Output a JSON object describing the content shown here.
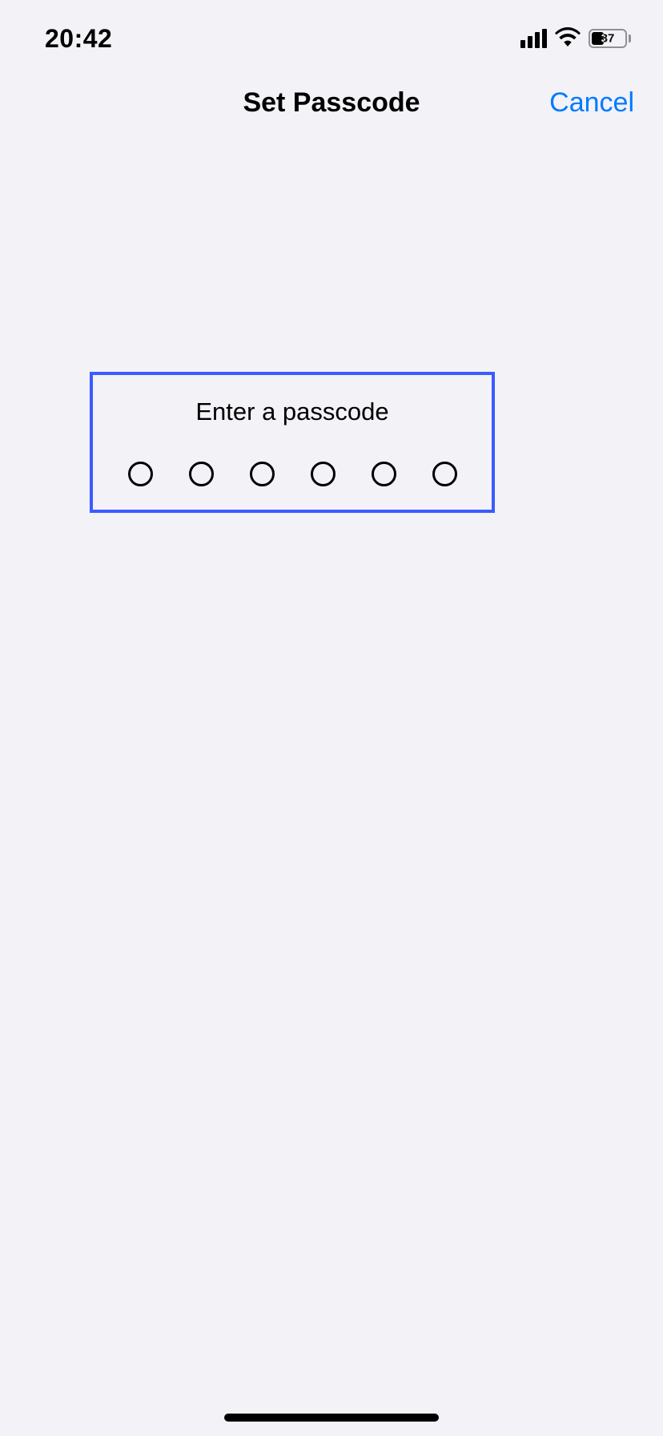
{
  "statusBar": {
    "time": "20:42",
    "batteryPercent": "37"
  },
  "navBar": {
    "title": "Set Passcode",
    "cancelLabel": "Cancel"
  },
  "passcode": {
    "prompt": "Enter a passcode",
    "length": 6,
    "filled": 0
  }
}
